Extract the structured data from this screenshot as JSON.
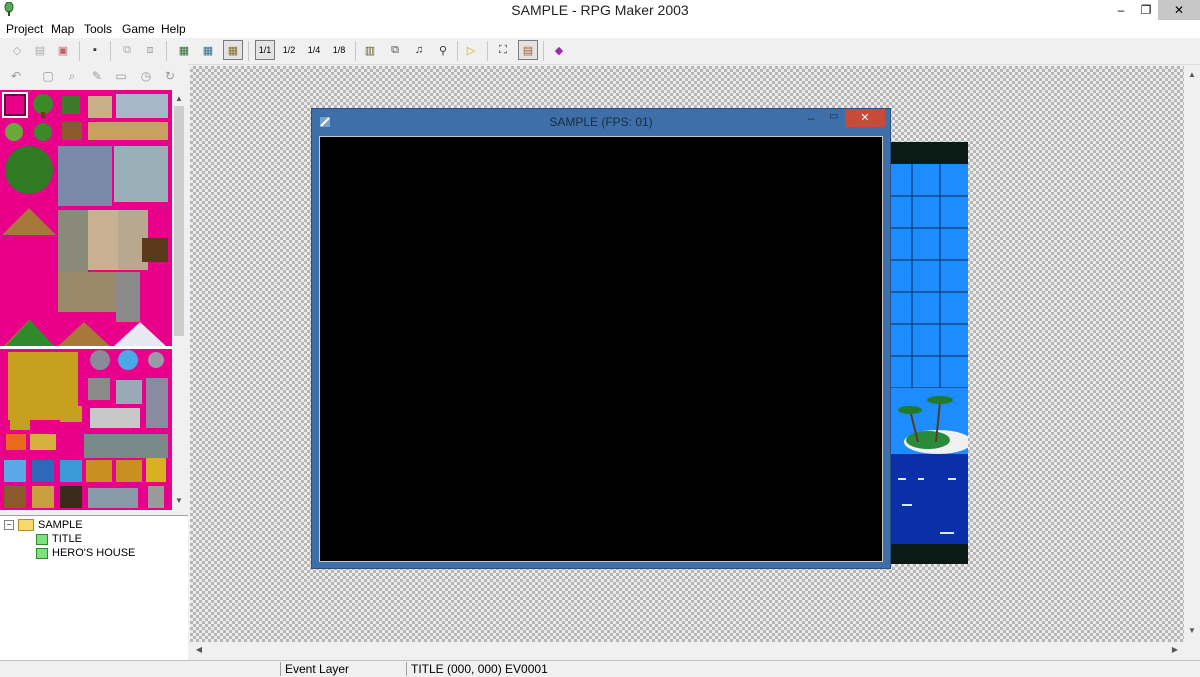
{
  "window": {
    "title": "SAMPLE - RPG Maker 2003",
    "minimize": "–",
    "restore": "❐",
    "close": "✕"
  },
  "menu": [
    "Project",
    "Map",
    "Tools",
    "Game",
    "Help"
  ],
  "toolbar_icons": [
    "open-project-icon",
    "new-project-icon",
    "close-project-icon",
    "save-icon",
    "undo-icon",
    "redo-icon",
    "lower-layer-icon",
    "upper-layer-icon",
    "event-layer-icon",
    "zoom-1-1-icon",
    "zoom-1-2-icon",
    "zoom-1-4-icon",
    "zoom-1-8-icon",
    "database-icon",
    "resource-manager-icon",
    "sound-test-icon",
    "search-icon",
    "playtest-icon",
    "fullscreen-icon",
    "title-screen-icon",
    "help-book-icon"
  ],
  "zoom_labels": [
    "1/1",
    "1/2",
    "1/4",
    "1/8"
  ],
  "sub_tools": [
    "↶",
    "▢",
    "⌕",
    "✎",
    "▭",
    "◷",
    "↻"
  ],
  "tree": {
    "root": "SAMPLE",
    "maps": [
      "TITLE",
      "HERO'S HOUSE"
    ]
  },
  "game_window": {
    "title": "SAMPLE (FPS: 01)"
  },
  "status": {
    "layer": "Event Layer",
    "position": "TITLE (000, 000) EV0001"
  },
  "colors": {
    "palette_bg": "#e8008a",
    "water": "#1c8cff",
    "game_frame": "#3e6fa8"
  }
}
